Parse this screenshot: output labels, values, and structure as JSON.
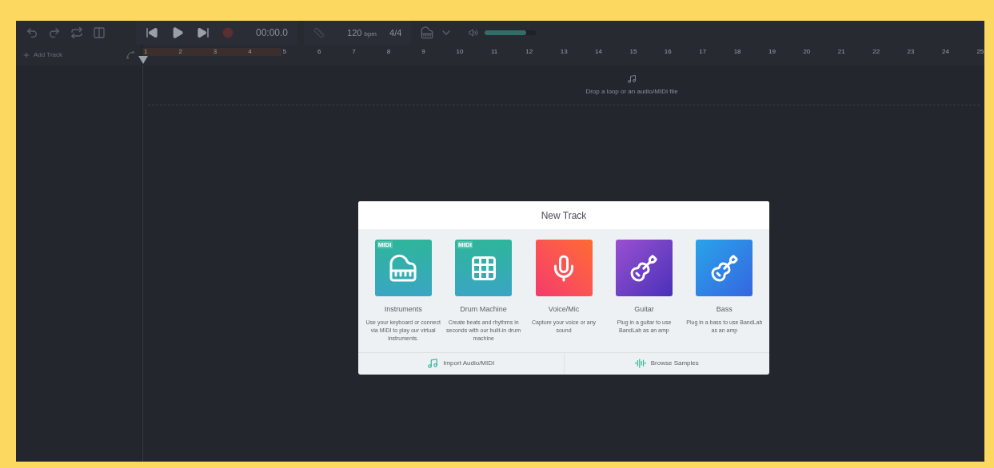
{
  "toolbar": {
    "time": "00:00.0",
    "tempo": "120",
    "tempo_unit": "bpm",
    "time_signature": "4/4",
    "volume": {
      "level": 0.8
    }
  },
  "track_panel": {
    "add_track": "Add Track"
  },
  "ruler": [
    {
      "label": "1",
      "in_loop": true
    },
    {
      "label": "2",
      "in_loop": true
    },
    {
      "label": "3",
      "in_loop": true
    },
    {
      "label": "4",
      "in_loop": true
    },
    {
      "label": "5",
      "in_loop": false
    },
    {
      "label": "6",
      "in_loop": false
    },
    {
      "label": "7",
      "in_loop": false
    },
    {
      "label": "8",
      "in_loop": false
    },
    {
      "label": "9",
      "in_loop": false
    },
    {
      "label": "10",
      "in_loop": false
    },
    {
      "label": "11",
      "in_loop": false
    },
    {
      "label": "12",
      "in_loop": false
    },
    {
      "label": "13",
      "in_loop": false
    },
    {
      "label": "14",
      "in_loop": false
    },
    {
      "label": "15",
      "in_loop": false
    },
    {
      "label": "16",
      "in_loop": false
    },
    {
      "label": "17",
      "in_loop": false
    },
    {
      "label": "18",
      "in_loop": false
    },
    {
      "label": "19",
      "in_loop": false
    },
    {
      "label": "20",
      "in_loop": false
    },
    {
      "label": "21",
      "in_loop": false
    },
    {
      "label": "22",
      "in_loop": false
    },
    {
      "label": "23",
      "in_loop": false
    },
    {
      "label": "24",
      "in_loop": false
    },
    {
      "label": "25",
      "in_loop": false
    }
  ],
  "drop_zone": {
    "hint": "Drop a loop or an audio/MIDI file"
  },
  "dialog": {
    "title": "New Track",
    "options": [
      {
        "kind": "instruments",
        "badge": "MIDI",
        "label": "Instruments",
        "description": "Use your keyboard or connect via MIDI to play our virtual instruments."
      },
      {
        "kind": "drums",
        "badge": "MIDI",
        "label": "Drum Machine",
        "description": "Create beats and rhythms in seconds with our built-in drum machine"
      },
      {
        "kind": "voice",
        "label": "Voice/Mic",
        "description": "Capture your voice or any sound"
      },
      {
        "kind": "guitar",
        "label": "Guitar",
        "description": "Plug in a guitar to use BandLab as an amp"
      },
      {
        "kind": "bass",
        "label": "Bass",
        "description": "Plug in a bass to use BandLab as an amp"
      }
    ],
    "footer": [
      {
        "kind": "import",
        "label": "Import Audio/MIDI"
      },
      {
        "kind": "samples",
        "label": "Browse Samples"
      }
    ]
  }
}
